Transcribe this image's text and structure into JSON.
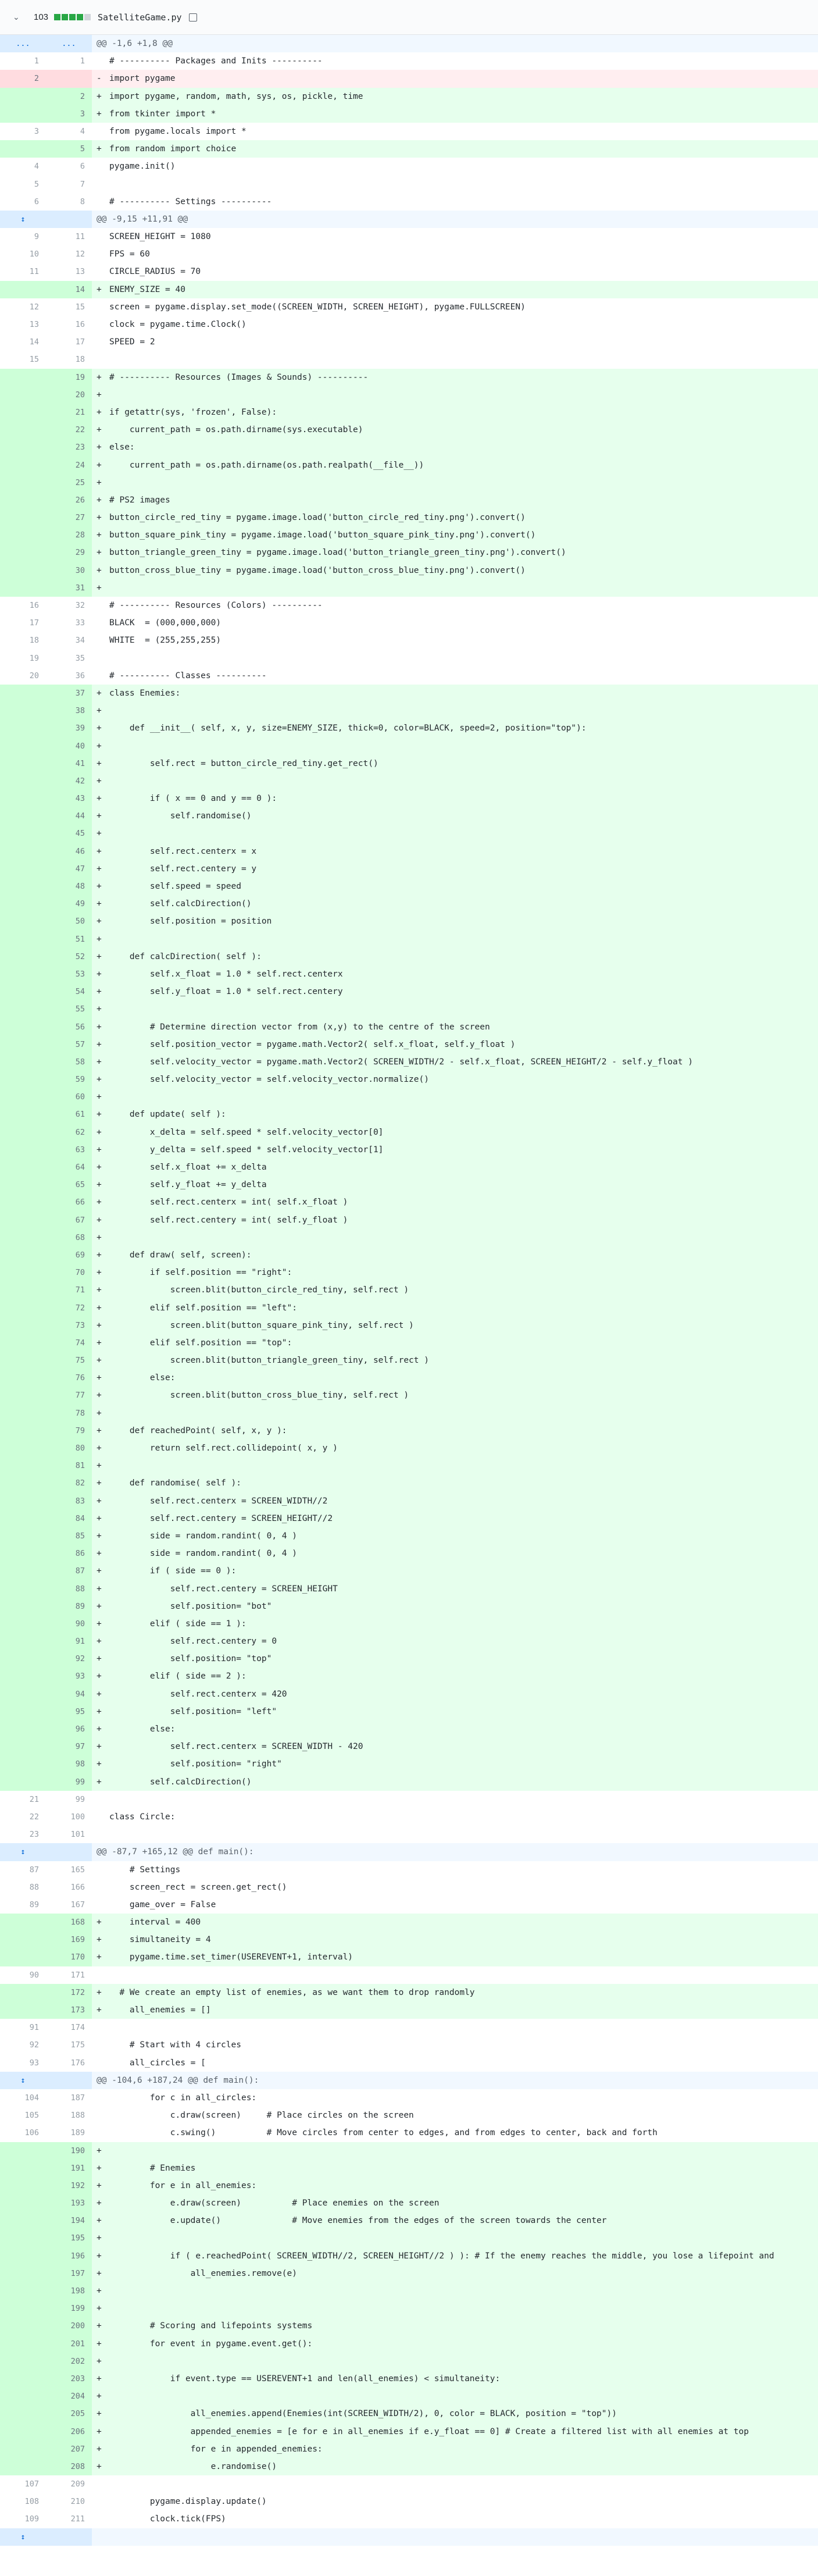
{
  "header": {
    "lines_changed": "103",
    "filename": "SatelliteGame.py",
    "diffstat_colors": [
      "#28a745",
      "#28a745",
      "#28a745",
      "#28a745",
      "#d1d5da"
    ]
  },
  "lines": [
    {
      "t": "hunk",
      "o": "...",
      "n": "...",
      "c": "@@ -1,6 +1,8 @@"
    },
    {
      "t": "ctx",
      "o": "1",
      "n": "1",
      "c": "# ---------- Packages and Inits ----------"
    },
    {
      "t": "del",
      "o": "2",
      "n": "",
      "c": "import pygame"
    },
    {
      "t": "add",
      "o": "",
      "n": "2",
      "c": "import pygame, random, math, sys, os, pickle, time"
    },
    {
      "t": "add",
      "o": "",
      "n": "3",
      "c": "from tkinter import *"
    },
    {
      "t": "ctx",
      "o": "3",
      "n": "4",
      "c": "from pygame.locals import *"
    },
    {
      "t": "add",
      "o": "",
      "n": "5",
      "c": "from random import choice"
    },
    {
      "t": "ctx",
      "o": "4",
      "n": "6",
      "c": "pygame.init()"
    },
    {
      "t": "ctx",
      "o": "5",
      "n": "7",
      "c": ""
    },
    {
      "t": "ctx",
      "o": "6",
      "n": "8",
      "c": "# ---------- Settings ----------"
    },
    {
      "t": "hunk",
      "o": "↕",
      "n": "",
      "c": "@@ -9,15 +11,91 @@"
    },
    {
      "t": "ctx",
      "o": "9",
      "n": "11",
      "c": "SCREEN_HEIGHT = 1080"
    },
    {
      "t": "ctx",
      "o": "10",
      "n": "12",
      "c": "FPS = 60"
    },
    {
      "t": "ctx",
      "o": "11",
      "n": "13",
      "c": "CIRCLE_RADIUS = 70"
    },
    {
      "t": "add",
      "o": "",
      "n": "14",
      "c": "ENEMY_SIZE = 40"
    },
    {
      "t": "ctx",
      "o": "12",
      "n": "15",
      "c": "screen = pygame.display.set_mode((SCREEN_WIDTH, SCREEN_HEIGHT), pygame.FULLSCREEN)"
    },
    {
      "t": "ctx",
      "o": "13",
      "n": "16",
      "c": "clock = pygame.time.Clock()"
    },
    {
      "t": "ctx",
      "o": "14",
      "n": "17",
      "c": "SPEED = 2"
    },
    {
      "t": "ctx",
      "o": "15",
      "n": "18",
      "c": ""
    },
    {
      "t": "add",
      "o": "",
      "n": "19",
      "c": "# ---------- Resources (Images & Sounds) ----------"
    },
    {
      "t": "add",
      "o": "",
      "n": "20",
      "c": ""
    },
    {
      "t": "add",
      "o": "",
      "n": "21",
      "c": "if getattr(sys, 'frozen', False):"
    },
    {
      "t": "add",
      "o": "",
      "n": "22",
      "c": "    current_path = os.path.dirname(sys.executable)"
    },
    {
      "t": "add",
      "o": "",
      "n": "23",
      "c": "else:"
    },
    {
      "t": "add",
      "o": "",
      "n": "24",
      "c": "    current_path = os.path.dirname(os.path.realpath(__file__))"
    },
    {
      "t": "add",
      "o": "",
      "n": "25",
      "c": ""
    },
    {
      "t": "add",
      "o": "",
      "n": "26",
      "c": "# PS2 images"
    },
    {
      "t": "add",
      "o": "",
      "n": "27",
      "c": "button_circle_red_tiny = pygame.image.load('button_circle_red_tiny.png').convert()"
    },
    {
      "t": "add",
      "o": "",
      "n": "28",
      "c": "button_square_pink_tiny = pygame.image.load('button_square_pink_tiny.png').convert()"
    },
    {
      "t": "add",
      "o": "",
      "n": "29",
      "c": "button_triangle_green_tiny = pygame.image.load('button_triangle_green_tiny.png').convert()"
    },
    {
      "t": "add",
      "o": "",
      "n": "30",
      "c": "button_cross_blue_tiny = pygame.image.load('button_cross_blue_tiny.png').convert()"
    },
    {
      "t": "add",
      "o": "",
      "n": "31",
      "c": ""
    },
    {
      "t": "ctx",
      "o": "16",
      "n": "32",
      "c": "# ---------- Resources (Colors) ----------"
    },
    {
      "t": "ctx",
      "o": "17",
      "n": "33",
      "c": "BLACK  = (000,000,000)"
    },
    {
      "t": "ctx",
      "o": "18",
      "n": "34",
      "c": "WHITE  = (255,255,255)"
    },
    {
      "t": "ctx",
      "o": "19",
      "n": "35",
      "c": ""
    },
    {
      "t": "ctx",
      "o": "20",
      "n": "36",
      "c": "# ---------- Classes ----------"
    },
    {
      "t": "add",
      "o": "",
      "n": "37",
      "c": "class Enemies:"
    },
    {
      "t": "add",
      "o": "",
      "n": "38",
      "c": ""
    },
    {
      "t": "add",
      "o": "",
      "n": "39",
      "c": "    def __init__( self, x, y, size=ENEMY_SIZE, thick=0, color=BLACK, speed=2, position=\"top\"):"
    },
    {
      "t": "add",
      "o": "",
      "n": "40",
      "c": ""
    },
    {
      "t": "add",
      "o": "",
      "n": "41",
      "c": "        self.rect = button_circle_red_tiny.get_rect()"
    },
    {
      "t": "add",
      "o": "",
      "n": "42",
      "c": ""
    },
    {
      "t": "add",
      "o": "",
      "n": "43",
      "c": "        if ( x == 0 and y == 0 ):"
    },
    {
      "t": "add",
      "o": "",
      "n": "44",
      "c": "            self.randomise()"
    },
    {
      "t": "add",
      "o": "",
      "n": "45",
      "c": ""
    },
    {
      "t": "add",
      "o": "",
      "n": "46",
      "c": "        self.rect.centerx = x"
    },
    {
      "t": "add",
      "o": "",
      "n": "47",
      "c": "        self.rect.centery = y"
    },
    {
      "t": "add",
      "o": "",
      "n": "48",
      "c": "        self.speed = speed"
    },
    {
      "t": "add",
      "o": "",
      "n": "49",
      "c": "        self.calcDirection()"
    },
    {
      "t": "add",
      "o": "",
      "n": "50",
      "c": "        self.position = position"
    },
    {
      "t": "add",
      "o": "",
      "n": "51",
      "c": ""
    },
    {
      "t": "add",
      "o": "",
      "n": "52",
      "c": "    def calcDirection( self ):"
    },
    {
      "t": "add",
      "o": "",
      "n": "53",
      "c": "        self.x_float = 1.0 * self.rect.centerx"
    },
    {
      "t": "add",
      "o": "",
      "n": "54",
      "c": "        self.y_float = 1.0 * self.rect.centery"
    },
    {
      "t": "add",
      "o": "",
      "n": "55",
      "c": ""
    },
    {
      "t": "add",
      "o": "",
      "n": "56",
      "c": "        # Determine direction vector from (x,y) to the centre of the screen"
    },
    {
      "t": "add",
      "o": "",
      "n": "57",
      "c": "        self.position_vector = pygame.math.Vector2( self.x_float, self.y_float )"
    },
    {
      "t": "add",
      "o": "",
      "n": "58",
      "c": "        self.velocity_vector = pygame.math.Vector2( SCREEN_WIDTH/2 - self.x_float, SCREEN_HEIGHT/2 - self.y_float )"
    },
    {
      "t": "add",
      "o": "",
      "n": "59",
      "c": "        self.velocity_vector = self.velocity_vector.normalize()"
    },
    {
      "t": "add",
      "o": "",
      "n": "60",
      "c": ""
    },
    {
      "t": "add",
      "o": "",
      "n": "61",
      "c": "    def update( self ):"
    },
    {
      "t": "add",
      "o": "",
      "n": "62",
      "c": "        x_delta = self.speed * self.velocity_vector[0]"
    },
    {
      "t": "add",
      "o": "",
      "n": "63",
      "c": "        y_delta = self.speed * self.velocity_vector[1]"
    },
    {
      "t": "add",
      "o": "",
      "n": "64",
      "c": "        self.x_float += x_delta"
    },
    {
      "t": "add",
      "o": "",
      "n": "65",
      "c": "        self.y_float += y_delta"
    },
    {
      "t": "add",
      "o": "",
      "n": "66",
      "c": "        self.rect.centerx = int( self.x_float )"
    },
    {
      "t": "add",
      "o": "",
      "n": "67",
      "c": "        self.rect.centery = int( self.y_float )"
    },
    {
      "t": "add",
      "o": "",
      "n": "68",
      "c": ""
    },
    {
      "t": "add",
      "o": "",
      "n": "69",
      "c": "    def draw( self, screen):"
    },
    {
      "t": "add",
      "o": "",
      "n": "70",
      "c": "        if self.position == \"right\":"
    },
    {
      "t": "add",
      "o": "",
      "n": "71",
      "c": "            screen.blit(button_circle_red_tiny, self.rect )"
    },
    {
      "t": "add",
      "o": "",
      "n": "72",
      "c": "        elif self.position == \"left\":"
    },
    {
      "t": "add",
      "o": "",
      "n": "73",
      "c": "            screen.blit(button_square_pink_tiny, self.rect )"
    },
    {
      "t": "add",
      "o": "",
      "n": "74",
      "c": "        elif self.position == \"top\":"
    },
    {
      "t": "add",
      "o": "",
      "n": "75",
      "c": "            screen.blit(button_triangle_green_tiny, self.rect )"
    },
    {
      "t": "add",
      "o": "",
      "n": "76",
      "c": "        else:"
    },
    {
      "t": "add",
      "o": "",
      "n": "77",
      "c": "            screen.blit(button_cross_blue_tiny, self.rect )"
    },
    {
      "t": "add",
      "o": "",
      "n": "78",
      "c": ""
    },
    {
      "t": "add",
      "o": "",
      "n": "79",
      "c": "    def reachedPoint( self, x, y ):"
    },
    {
      "t": "add",
      "o": "",
      "n": "80",
      "c": "        return self.rect.collidepoint( x, y )"
    },
    {
      "t": "add",
      "o": "",
      "n": "81",
      "c": ""
    },
    {
      "t": "add",
      "o": "",
      "n": "82",
      "c": "    def randomise( self ):"
    },
    {
      "t": "add",
      "o": "",
      "n": "83",
      "c": "        self.rect.centerx = SCREEN_WIDTH//2"
    },
    {
      "t": "add",
      "o": "",
      "n": "84",
      "c": "        self.rect.centery = SCREEN_HEIGHT//2"
    },
    {
      "t": "add",
      "o": "",
      "n": "85",
      "c": "        side = random.randint( 0, 4 )"
    },
    {
      "t": "add",
      "o": "",
      "n": "86",
      "c": "        side = random.randint( 0, 4 )"
    },
    {
      "t": "add",
      "o": "",
      "n": "87",
      "c": "        if ( side == 0 ):"
    },
    {
      "t": "add",
      "o": "",
      "n": "88",
      "c": "            self.rect.centery = SCREEN_HEIGHT"
    },
    {
      "t": "add",
      "o": "",
      "n": "89",
      "c": "            self.position= \"bot\""
    },
    {
      "t": "add",
      "o": "",
      "n": "90",
      "c": "        elif ( side == 1 ):"
    },
    {
      "t": "add",
      "o": "",
      "n": "91",
      "c": "            self.rect.centery = 0"
    },
    {
      "t": "add",
      "o": "",
      "n": "92",
      "c": "            self.position= \"top\""
    },
    {
      "t": "add",
      "o": "",
      "n": "93",
      "c": "        elif ( side == 2 ):"
    },
    {
      "t": "add",
      "o": "",
      "n": "94",
      "c": "            self.rect.centerx = 420"
    },
    {
      "t": "add",
      "o": "",
      "n": "95",
      "c": "            self.position= \"left\""
    },
    {
      "t": "add",
      "o": "",
      "n": "96",
      "c": "        else:"
    },
    {
      "t": "add",
      "o": "",
      "n": "97",
      "c": "            self.rect.centerx = SCREEN_WIDTH - 420"
    },
    {
      "t": "add",
      "o": "",
      "n": "98",
      "c": "            self.position= \"right\""
    },
    {
      "t": "add",
      "o": "",
      "n": "99",
      "c": "        self.calcDirection()"
    },
    {
      "t": "ctx",
      "o": "21",
      "n": "99",
      "c": ""
    },
    {
      "t": "ctx",
      "o": "22",
      "n": "100",
      "c": "class Circle:"
    },
    {
      "t": "ctx",
      "o": "23",
      "n": "101",
      "c": ""
    },
    {
      "t": "hunk",
      "o": "↕",
      "n": "",
      "c": "@@ -87,7 +165,12 @@ def main():"
    },
    {
      "t": "ctx",
      "o": "87",
      "n": "165",
      "c": "    # Settings"
    },
    {
      "t": "ctx",
      "o": "88",
      "n": "166",
      "c": "    screen_rect = screen.get_rect()"
    },
    {
      "t": "ctx",
      "o": "89",
      "n": "167",
      "c": "    game_over = False"
    },
    {
      "t": "add",
      "o": "",
      "n": "168",
      "c": "    interval = 400"
    },
    {
      "t": "add",
      "o": "",
      "n": "169",
      "c": "    simultaneity = 4"
    },
    {
      "t": "add",
      "o": "",
      "n": "170",
      "c": "    pygame.time.set_timer(USEREVENT+1, interval)"
    },
    {
      "t": "ctx",
      "o": "90",
      "n": "171",
      "c": ""
    },
    {
      "t": "add",
      "o": "",
      "n": "172",
      "c": "  # We create an empty list of enemies, as we want them to drop randomly"
    },
    {
      "t": "add",
      "o": "",
      "n": "173",
      "c": "    all_enemies = []"
    },
    {
      "t": "ctx",
      "o": "91",
      "n": "174",
      "c": ""
    },
    {
      "t": "ctx",
      "o": "92",
      "n": "175",
      "c": "    # Start with 4 circles"
    },
    {
      "t": "ctx",
      "o": "93",
      "n": "176",
      "c": "    all_circles = ["
    },
    {
      "t": "hunk",
      "o": "↕",
      "n": "",
      "c": "@@ -104,6 +187,24 @@ def main():"
    },
    {
      "t": "ctx",
      "o": "104",
      "n": "187",
      "c": "        for c in all_circles:"
    },
    {
      "t": "ctx",
      "o": "105",
      "n": "188",
      "c": "            c.draw(screen)     # Place circles on the screen"
    },
    {
      "t": "ctx",
      "o": "106",
      "n": "189",
      "c": "            c.swing()          # Move circles from center to edges, and from edges to center, back and forth"
    },
    {
      "t": "add",
      "o": "",
      "n": "190",
      "c": ""
    },
    {
      "t": "add",
      "o": "",
      "n": "191",
      "c": "        # Enemies"
    },
    {
      "t": "add",
      "o": "",
      "n": "192",
      "c": "        for e in all_enemies:"
    },
    {
      "t": "add",
      "o": "",
      "n": "193",
      "c": "            e.draw(screen)          # Place enemies on the screen"
    },
    {
      "t": "add",
      "o": "",
      "n": "194",
      "c": "            e.update()              # Move enemies from the edges of the screen towards the center"
    },
    {
      "t": "add",
      "o": "",
      "n": "195",
      "c": ""
    },
    {
      "t": "add",
      "o": "",
      "n": "196",
      "c": "            if ( e.reachedPoint( SCREEN_WIDTH//2, SCREEN_HEIGHT//2 ) ): # If the enemy reaches the middle, you lose a lifepoint and"
    },
    {
      "t": "add",
      "o": "",
      "n": "197",
      "c": "                all_enemies.remove(e)"
    },
    {
      "t": "add",
      "o": "",
      "n": "198",
      "c": ""
    },
    {
      "t": "add",
      "o": "",
      "n": "199",
      "c": ""
    },
    {
      "t": "add",
      "o": "",
      "n": "200",
      "c": "        # Scoring and lifepoints systems"
    },
    {
      "t": "add",
      "o": "",
      "n": "201",
      "c": "        for event in pygame.event.get():"
    },
    {
      "t": "add",
      "o": "",
      "n": "202",
      "c": ""
    },
    {
      "t": "add",
      "o": "",
      "n": "203",
      "c": "            if event.type == USEREVENT+1 and len(all_enemies) < simultaneity:"
    },
    {
      "t": "add",
      "o": "",
      "n": "204",
      "c": ""
    },
    {
      "t": "add",
      "o": "",
      "n": "205",
      "c": "                all_enemies.append(Enemies(int(SCREEN_WIDTH/2), 0, color = BLACK, position = \"top\"))"
    },
    {
      "t": "add",
      "o": "",
      "n": "206",
      "c": "                appended_enemies = [e for e in all_enemies if e.y_float == 0] # Create a filtered list with all enemies at top"
    },
    {
      "t": "add",
      "o": "",
      "n": "207",
      "c": "                for e in appended_enemies:"
    },
    {
      "t": "add",
      "o": "",
      "n": "208",
      "c": "                    e.randomise()"
    },
    {
      "t": "ctx",
      "o": "107",
      "n": "209",
      "c": ""
    },
    {
      "t": "ctx",
      "o": "108",
      "n": "210",
      "c": "        pygame.display.update()"
    },
    {
      "t": "ctx",
      "o": "109",
      "n": "211",
      "c": "        clock.tick(FPS)"
    },
    {
      "t": "hunk",
      "o": "↕",
      "n": "",
      "c": ""
    }
  ]
}
